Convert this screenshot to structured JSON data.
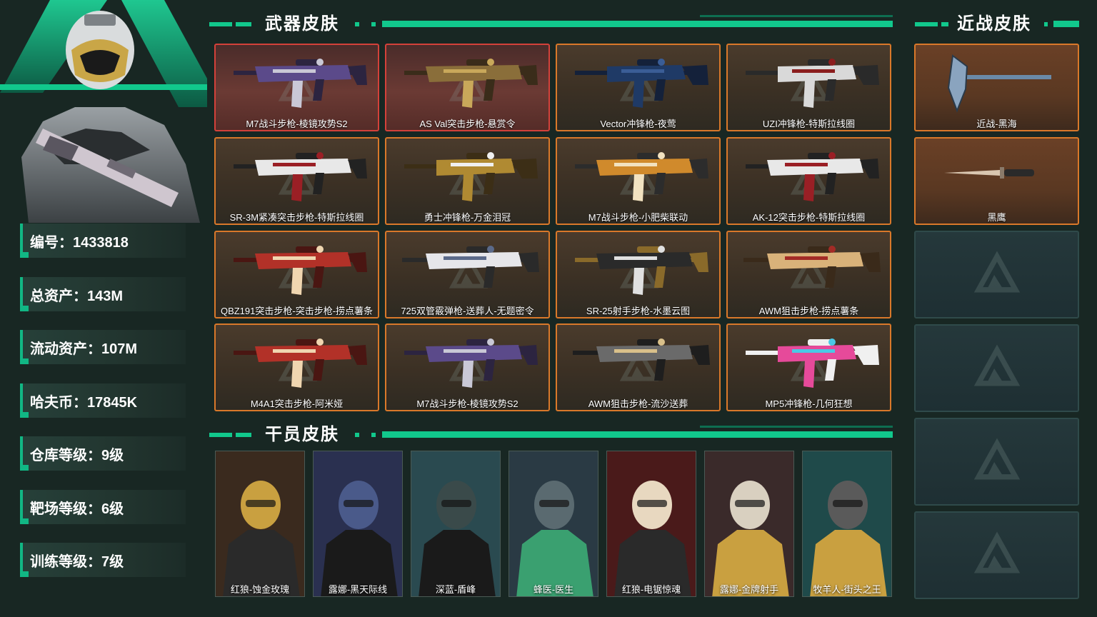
{
  "colors": {
    "accent": "#11c88c",
    "background": "#182723",
    "weapon_border": "#d9782a",
    "weapon_border_red": "#d4413a",
    "empty_slot_border": "#2f4a4a"
  },
  "profile": {
    "stats": [
      {
        "label": "编号",
        "value": "1433818",
        "text": "编号：1433818"
      },
      {
        "label": "总资产",
        "value": "143M",
        "text": "总资产：143M"
      },
      {
        "label": "流动资产",
        "value": "107M",
        "text": "流动资产：107M"
      },
      {
        "label": "哈夫币",
        "value": "17845K",
        "text": "哈夫币：17845K"
      },
      {
        "label": "仓库等级",
        "value": "9级",
        "text": "仓库等级：9级"
      },
      {
        "label": "靶场等级",
        "value": "6级",
        "text": "靶场等级：6级"
      },
      {
        "label": "训练等级",
        "value": "7级",
        "text": "训练等级：7级"
      }
    ]
  },
  "sections": {
    "weapon_title": "武器皮肤",
    "melee_title": "近战皮肤",
    "operator_title": "干员皮肤"
  },
  "weapons": [
    {
      "name": "M7战斗步枪-棱镜攻势S2",
      "rarity": "red",
      "icon": "rifle-purple"
    },
    {
      "name": "AS Val突击步枪-悬赏令",
      "rarity": "red",
      "icon": "rifle-gold"
    },
    {
      "name": "Vector冲锋枪-夜莺",
      "rarity": "orange",
      "icon": "smg-blue"
    },
    {
      "name": "UZI冲锋枪-特斯拉线圈",
      "rarity": "orange",
      "icon": "smg-white"
    },
    {
      "name": "SR-3M紧凑突击步枪-特斯拉线圈",
      "rarity": "orange",
      "icon": "rifle-white"
    },
    {
      "name": "勇士冲锋枪-万金泪冠",
      "rarity": "orange",
      "icon": "smg-gold"
    },
    {
      "name": "M7战斗步枪-小肥柴联动",
      "rarity": "orange",
      "icon": "rifle-orange"
    },
    {
      "name": "AK-12突击步枪-特斯拉线圈",
      "rarity": "orange",
      "icon": "rifle-white"
    },
    {
      "name": "QBZ191突击步枪-突击步枪-捞点薯条",
      "rarity": "orange",
      "icon": "rifle-red"
    },
    {
      "name": "725双管霰弹枪-送葬人-无题密令",
      "rarity": "orange",
      "icon": "shotgun-white"
    },
    {
      "name": "SR-25射手步枪-水墨云图",
      "rarity": "orange",
      "icon": "rifle-black"
    },
    {
      "name": "AWM狙击步枪-捞点薯条",
      "rarity": "orange",
      "icon": "sniper-red"
    },
    {
      "name": "M4A1突击步枪-阿米娅",
      "rarity": "orange",
      "icon": "rifle-red"
    },
    {
      "name": "M7战斗步枪-棱镜攻势S2",
      "rarity": "orange",
      "icon": "rifle-purple"
    },
    {
      "name": "AWM狙击步枪-流沙送葬",
      "rarity": "orange",
      "icon": "sniper-sand"
    },
    {
      "name": "MP5冲锋枪-几何狂想",
      "rarity": "orange",
      "icon": "smg-pink"
    }
  ],
  "melee": [
    {
      "name": "近战-黑海",
      "icon": "axe-icon"
    },
    {
      "name": "黑鹰",
      "icon": "knife-icon"
    }
  ],
  "melee_empty_slots": 4,
  "operators": [
    {
      "name": "红狼-蚀金玫瑰"
    },
    {
      "name": "露娜-黑天际线"
    },
    {
      "name": "深蓝-盾峰"
    },
    {
      "name": "蜂医-医生"
    },
    {
      "name": "红狼-电锯惊魂"
    },
    {
      "name": "露娜-金牌射手"
    },
    {
      "name": "牧羊人-街头之王"
    }
  ]
}
